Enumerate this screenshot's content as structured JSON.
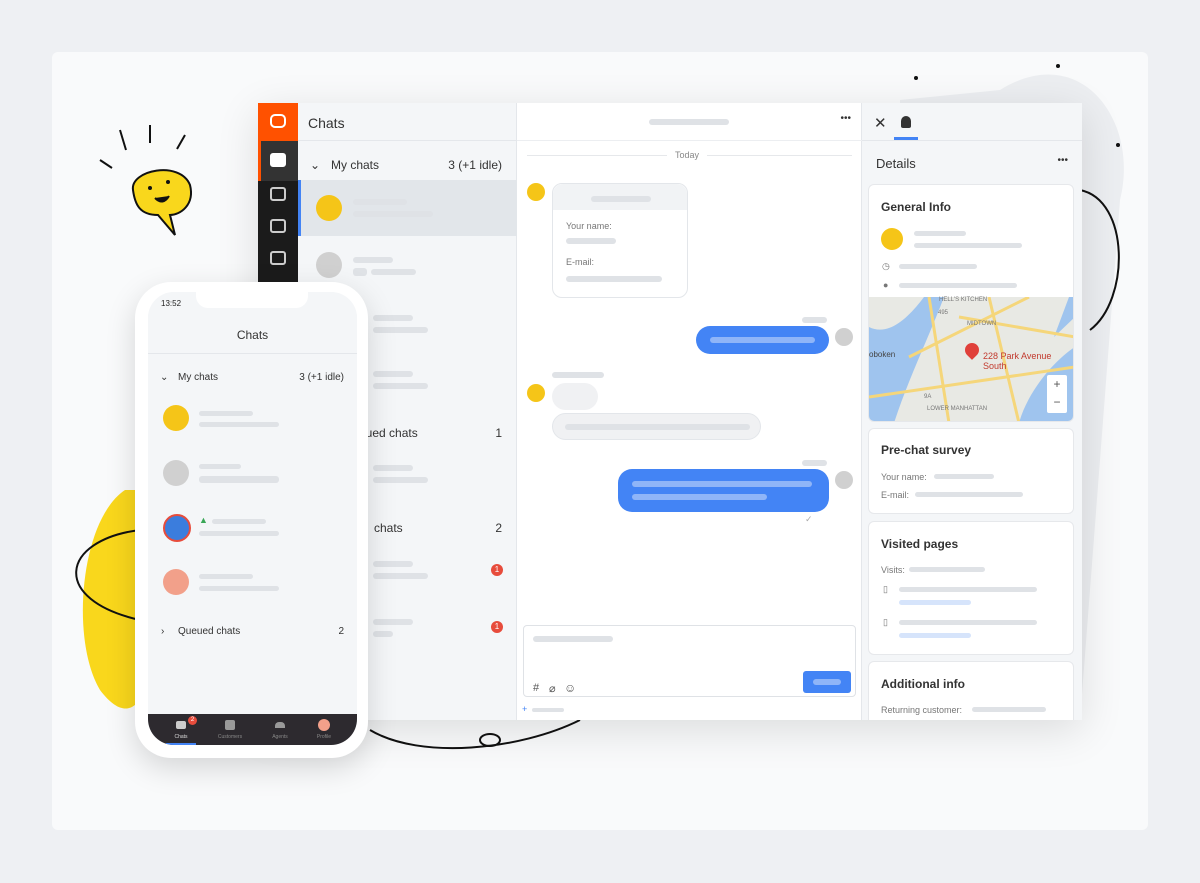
{
  "desktop": {
    "list": {
      "title": "Chats",
      "my_chats": {
        "label": "My chats",
        "count": "3 (+1 idle)"
      },
      "queued": {
        "label": "Queued chats",
        "count": "1"
      },
      "other": {
        "label": "chats",
        "count": "2"
      },
      "badges": [
        "1",
        "1"
      ]
    },
    "chat": {
      "date": "Today",
      "form": {
        "name_label": "Your name:",
        "email_label": "E-mail:"
      },
      "menu": "•••"
    },
    "details": {
      "title": "Details",
      "menu": "•••",
      "close": "✕",
      "general_info": "General Info",
      "map": {
        "address": "228 Park Avenue South",
        "labels": [
          "HELL'S KITCHEN",
          "MIDTOWN",
          "oboken",
          "LOWER MANHATTAN",
          "495",
          "9A"
        ],
        "zoom_in": "+",
        "zoom_out": "−"
      },
      "prechat": {
        "title": "Pre-chat survey",
        "name": "Your name:",
        "email": "E-mail:"
      },
      "visited": {
        "title": "Visited pages",
        "visits": "Visits:"
      },
      "additional": {
        "title": "Additional info",
        "returning": "Returning customer:"
      }
    },
    "composer": {
      "hash": "#",
      "clip": "⌀",
      "emoji": "☺",
      "add": "+"
    }
  },
  "phone": {
    "time": "13:52",
    "title": "Chats",
    "my_chats": {
      "label": "My chats",
      "count": "3 (+1 idle)"
    },
    "queued": {
      "label": "Queued chats",
      "count": "2"
    },
    "nav": [
      {
        "label": "Chats",
        "badge": "2"
      },
      {
        "label": "Customers"
      },
      {
        "label": "Agents"
      },
      {
        "label": "Profile"
      }
    ]
  },
  "colors": {
    "brand": "#ff5100",
    "accent": "#4384f5",
    "mascot": "#f9d71c"
  }
}
